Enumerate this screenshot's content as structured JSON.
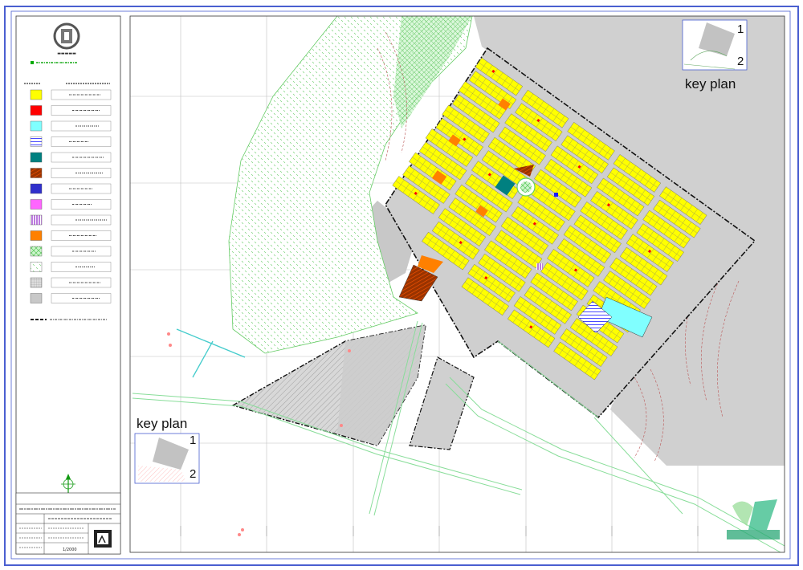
{
  "key_plan_top": {
    "label": "key plan",
    "num1": "1",
    "num2": "2"
  },
  "key_plan_bottom": {
    "label": "key plan",
    "num1": "1",
    "num2": "2"
  },
  "title_block": {
    "scale": "1/2000"
  },
  "colors": {
    "residential": "#ffff00",
    "commercial": "#ff0000",
    "water": "#80ffff",
    "educational": "#0000ff",
    "religious": "#008080",
    "sport": "#993300",
    "cultural": "#ff00ff",
    "industrial": "#ff8000",
    "green": "#00cc66",
    "vacant": "#c8c8c8"
  },
  "legend_items": [
    {
      "swatch": "#ffff00",
      "pattern": "solid"
    },
    {
      "swatch": "#ff0000",
      "pattern": "solid"
    },
    {
      "swatch": "#80ffff",
      "pattern": "solid"
    },
    {
      "swatch": "#0000ff",
      "pattern": "vstripe"
    },
    {
      "swatch": "#008080",
      "pattern": "solid-icon"
    },
    {
      "swatch": "#993300",
      "pattern": "dstripe"
    },
    {
      "swatch": "#3030cc",
      "pattern": "solid-small"
    },
    {
      "swatch": "#ff66ff",
      "pattern": "solid"
    },
    {
      "swatch": "#cc66ff",
      "pattern": "vstripe"
    },
    {
      "swatch": "#ff8000",
      "pattern": "solid"
    },
    {
      "swatch": "#66dd66",
      "pattern": "cross"
    },
    {
      "swatch": "#aaddaa",
      "pattern": "dots"
    },
    {
      "swatch": "#aaaaaa",
      "pattern": "grid"
    },
    {
      "swatch": "#c8c8c8",
      "pattern": "solid"
    }
  ]
}
